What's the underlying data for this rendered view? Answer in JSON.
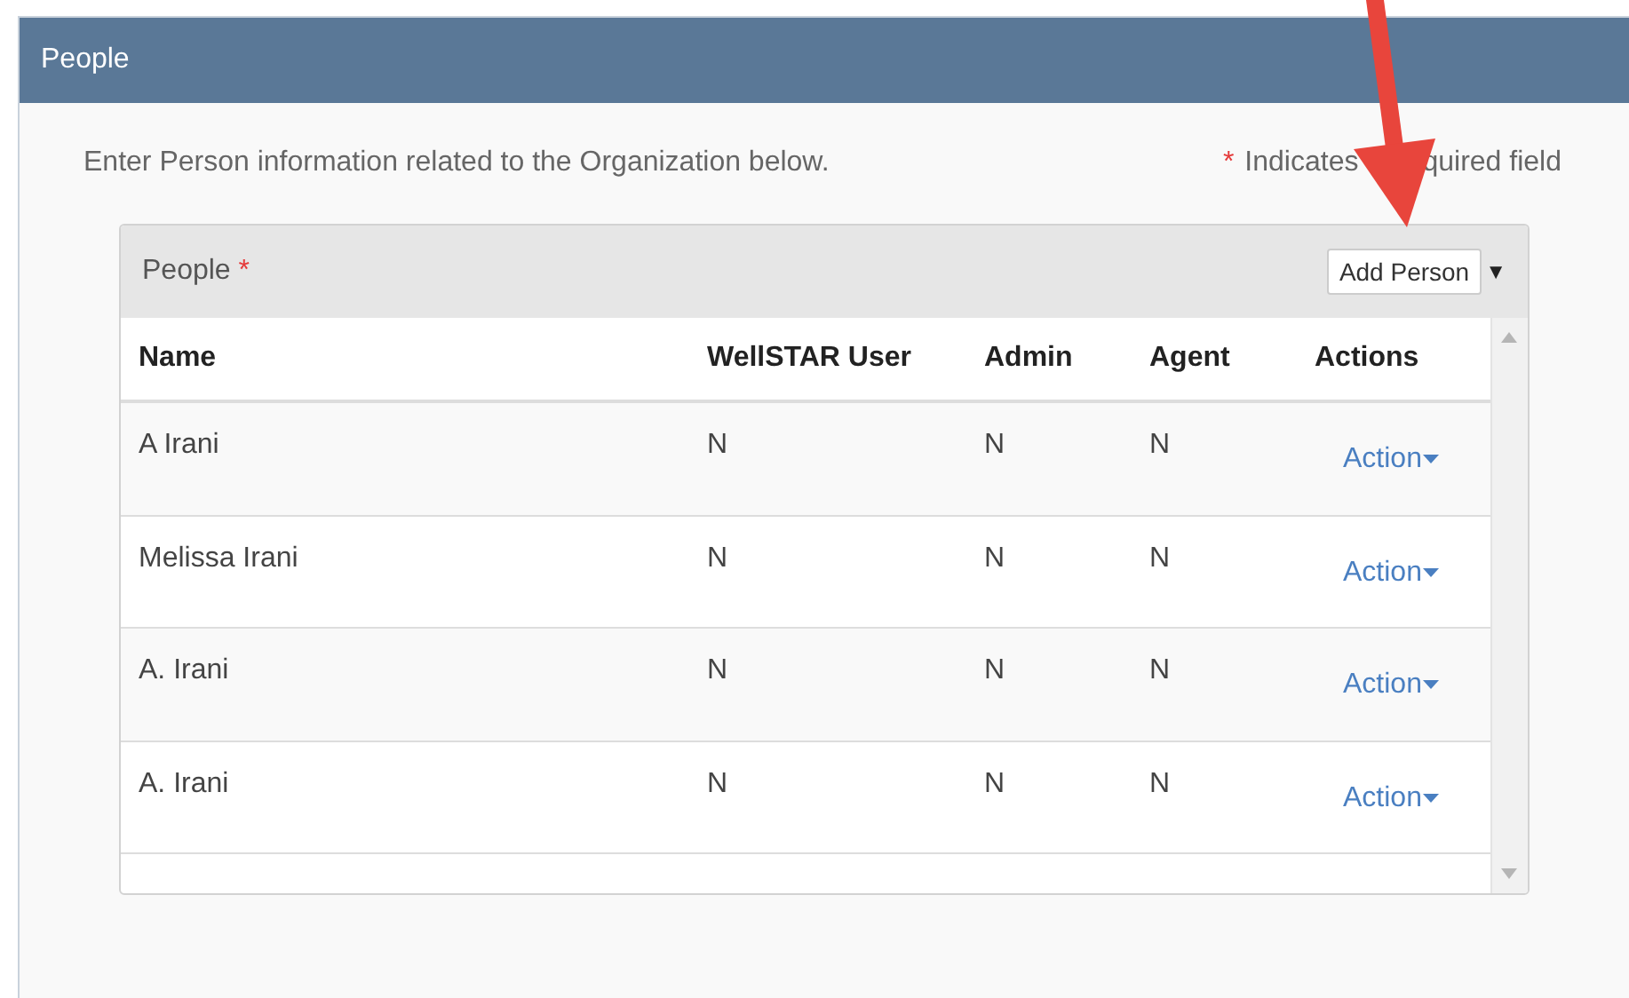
{
  "panel": {
    "title": "People"
  },
  "intro": "Enter Person information related to the Organization below.",
  "required_note": {
    "marker": "*",
    "text_parts": [
      "Indicates",
      "quired field"
    ]
  },
  "people": {
    "title": "People",
    "required_marker": "*",
    "add_button": "Add Person",
    "dropdown_caret": "▼",
    "columns": [
      "Name",
      "WellSTAR User",
      "Admin",
      "Agent",
      "Actions"
    ],
    "rows": [
      {
        "name": "A Irani",
        "wellstar_user": "N",
        "admin": "N",
        "agent": "N",
        "action": "Action"
      },
      {
        "name": "Melissa Irani",
        "wellstar_user": "N",
        "admin": "N",
        "agent": "N",
        "action": "Action"
      },
      {
        "name": "A. Irani",
        "wellstar_user": "N",
        "admin": "N",
        "agent": "N",
        "action": "Action"
      },
      {
        "name": "A. Irani",
        "wellstar_user": "N",
        "admin": "N",
        "agent": "N",
        "action": "Action"
      }
    ]
  }
}
